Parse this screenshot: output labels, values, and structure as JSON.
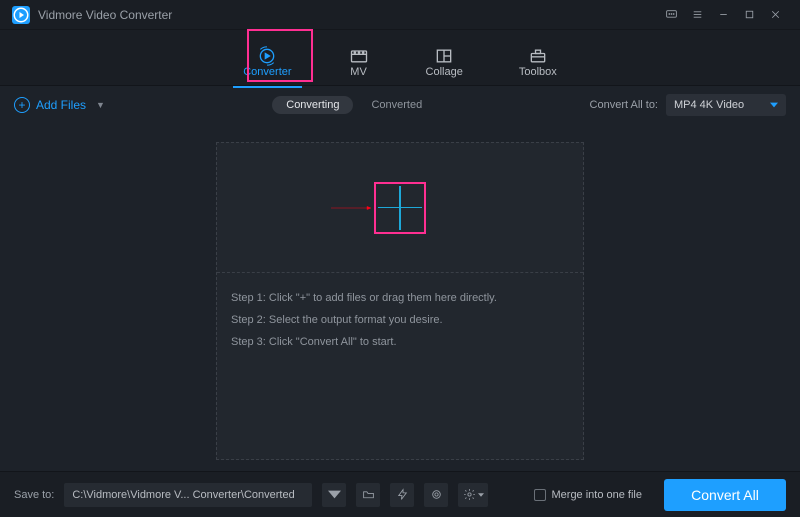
{
  "app": {
    "title": "Vidmore Video Converter"
  },
  "nav": {
    "tabs": [
      {
        "label": "Converter"
      },
      {
        "label": "MV"
      },
      {
        "label": "Collage"
      },
      {
        "label": "Toolbox"
      }
    ]
  },
  "toolbar": {
    "add_files": "Add Files",
    "converting": "Converting",
    "converted": "Converted",
    "convert_all_to_label": "Convert All to:",
    "format_selected": "MP4 4K Video"
  },
  "dropzone": {
    "step1": "Step 1: Click \"+\" to add files or drag them here directly.",
    "step2": "Step 2: Select the output format you desire.",
    "step3": "Step 3: Click \"Convert All\" to start."
  },
  "bottom": {
    "save_to_label": "Save to:",
    "path": "C:\\Vidmore\\Vidmore V... Converter\\Converted",
    "merge_label": "Merge into one file",
    "convert_all": "Convert All"
  }
}
